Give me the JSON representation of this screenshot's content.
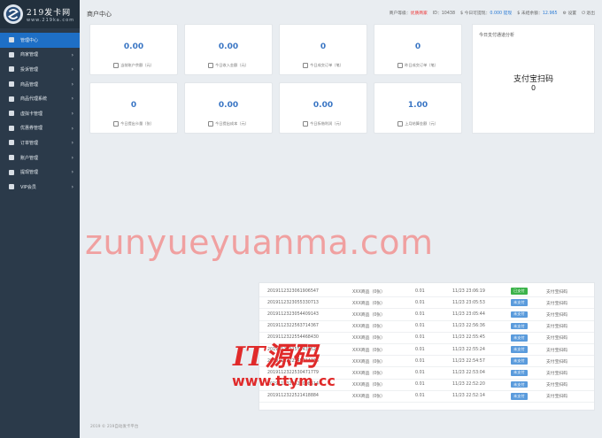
{
  "logo": {
    "title": "219发卡网",
    "sub": "www.219ka.com"
  },
  "nav": [
    {
      "label": "管理中心",
      "active": true,
      "chev": false
    },
    {
      "label": "商家管理",
      "active": false,
      "chev": true
    },
    {
      "label": "投诉管理",
      "active": false,
      "chev": true
    },
    {
      "label": "商品管理",
      "active": false,
      "chev": true
    },
    {
      "label": "商品代理系统",
      "active": false,
      "chev": true
    },
    {
      "label": "虚拟卡管理",
      "active": false,
      "chev": true
    },
    {
      "label": "优惠券管理",
      "active": false,
      "chev": true
    },
    {
      "label": "订单管理",
      "active": false,
      "chev": true
    },
    {
      "label": "账户管理",
      "active": false,
      "chev": true
    },
    {
      "label": "提现管理",
      "active": false,
      "chev": true
    },
    {
      "label": "VIP会员",
      "active": false,
      "chev": true
    }
  ],
  "header": {
    "title": "商户中心",
    "level_label": "商户等级：",
    "level_value": "优质商家",
    "id_text": "ID：10438",
    "withdraw_label": "$ 今日可提现：",
    "withdraw_value": "0.000",
    "withdraw_link": "提现",
    "balance_label": "$ 未结余额：",
    "balance_value": "12.965",
    "settings": "设置",
    "logout": "退出"
  },
  "cards": [
    {
      "value": "0.00",
      "label": "当前账户余额（元）"
    },
    {
      "value": "0.00",
      "label": "今日收入金额（元）"
    },
    {
      "value": "0",
      "label": "今日成交订单（笔）"
    },
    {
      "value": "0",
      "label": "昨日成交订单（笔）"
    },
    {
      "value": "0",
      "label": "今日提出卡量（张）"
    },
    {
      "value": "0.00",
      "label": "今日提出成本（元）"
    },
    {
      "value": "0.00",
      "label": "今日拆借利润（元）"
    },
    {
      "value": "1.00",
      "label": "上月结算金额（元）"
    }
  ],
  "alipay": {
    "title": "今日支付通道分析",
    "name": "支付宝扫码",
    "value": "0"
  },
  "watermark": {
    "main": "zunyueyuanma.com",
    "logo": "IT源码",
    "url": "www.ttym.cc"
  },
  "orders": [
    {
      "no": "20191123230619065​47",
      "name": "XXX商品（0张）",
      "amount": "0.01",
      "time": "11/23 23:06:19",
      "status": "已支付",
      "paid": true,
      "channel": "支付宝扫码"
    },
    {
      "no": "2019112323055330713",
      "name": "XXX商品（0张）",
      "amount": "0.01",
      "time": "11/23 23:05:53",
      "status": "未支付",
      "paid": false,
      "channel": "支付宝扫码"
    },
    {
      "no": "2019112323054409143",
      "name": "XXX商品（0张）",
      "amount": "0.01",
      "time": "11/23 23:05:44",
      "status": "未支付",
      "paid": false,
      "channel": "支付宝扫码"
    },
    {
      "no": "2019112322563714367",
      "name": "XXX商品（0张）",
      "amount": "0.01",
      "time": "11/23 22:56:36",
      "status": "未支付",
      "paid": false,
      "channel": "支付宝扫码"
    },
    {
      "no": "2019112322554468430",
      "name": "XXX商品（0张）",
      "amount": "0.01",
      "time": "11/23 22:55:45",
      "status": "未支付",
      "paid": false,
      "channel": "支付宝扫码"
    },
    {
      "no": "2019112322552437528",
      "name": "XXX商品（0张）",
      "amount": "0.01",
      "time": "11/23 22:55:24",
      "status": "未支付",
      "paid": false,
      "channel": "支付宝扫码"
    },
    {
      "no": "2019112322545714316",
      "name": "XXX商品（0张）",
      "amount": "0.01",
      "time": "11/23 22:54:57",
      "status": "未支付",
      "paid": false,
      "channel": "支付宝扫码"
    },
    {
      "no": "2019112322530471779",
      "name": "XXX商品（0张）",
      "amount": "0.01",
      "time": "11/23 22:53:04",
      "status": "未支付",
      "paid": false,
      "channel": "支付宝扫码"
    },
    {
      "no": "2019112322522008514",
      "name": "XXX商品（0张）",
      "amount": "0.01",
      "time": "11/23 22:52:20",
      "status": "未支付",
      "paid": false,
      "channel": "支付宝扫码"
    },
    {
      "no": "2019112322521418884",
      "name": "XXX商品（0张）",
      "amount": "0.01",
      "time": "11/23 22:52:14",
      "status": "未支付",
      "paid": false,
      "channel": "支付宝扫码"
    }
  ],
  "footer": "2019 © 219自动发卡平台"
}
